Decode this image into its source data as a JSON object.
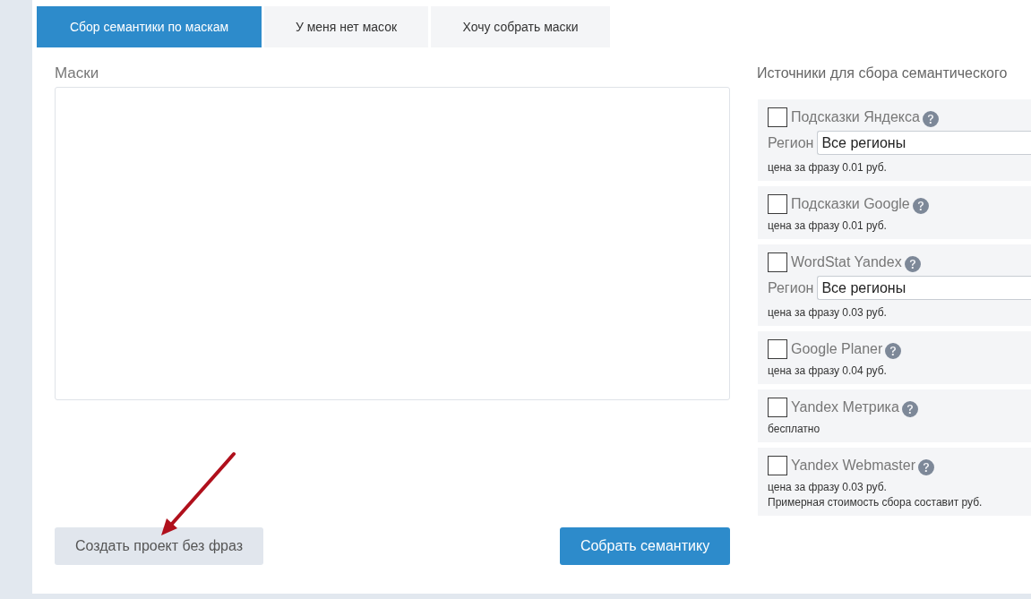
{
  "tabs": [
    {
      "label": "Сбор семантики по маскам",
      "selected": true
    },
    {
      "label": "У меня нет масок",
      "selected": false
    },
    {
      "label": "Хочу собрать маски",
      "selected": false
    }
  ],
  "masks": {
    "label": "Маски"
  },
  "sources": {
    "title": "Источники для сбора семантического",
    "items": [
      {
        "name": "Подсказки Яндекса",
        "checked": false,
        "region": {
          "label": "Регион",
          "value": "Все регионы"
        },
        "notes": [
          "цена за фразу 0.01 руб."
        ]
      },
      {
        "name": "Подсказки Google",
        "checked": false,
        "notes": [
          "цена за фразу 0.01 руб."
        ]
      },
      {
        "name": "WordStat Yandex",
        "checked": false,
        "region": {
          "label": "Регион",
          "value": "Все регионы"
        },
        "notes": [
          "цена за фразу 0.03 руб."
        ]
      },
      {
        "name": "Google Planer",
        "checked": false,
        "notes": [
          "цена за фразу 0.04 руб."
        ]
      },
      {
        "name": "Yandex Метрика",
        "checked": false,
        "notes": [
          "бесплатно"
        ]
      },
      {
        "name": "Yandex Webmaster",
        "checked": false,
        "notes": [
          "цена за фразу 0.03 руб.",
          "Примерная стоимость сбора составит руб."
        ]
      }
    ]
  },
  "buttons": [
    {
      "label": "Создать проект без фраз",
      "kind": "secondary"
    },
    {
      "label": "Собрать семантику",
      "kind": "primary"
    }
  ]
}
